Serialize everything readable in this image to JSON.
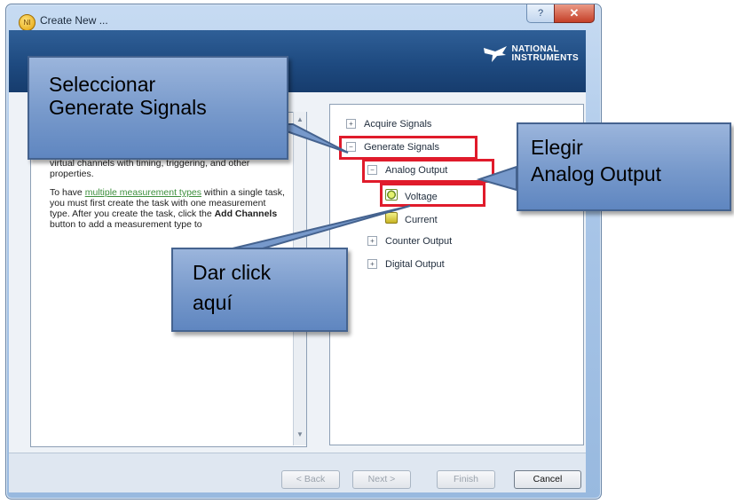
{
  "window": {
    "title": "Create New ...",
    "help_button": "?",
    "close_button": "✕"
  },
  "banner": {
    "logo_line1": "NATIONAL",
    "logo_line2": "INSTRUMENTS"
  },
  "help_panel": {
    "para1_fragment": "virtual channels with timing, triggering, and other properties.",
    "para2_pre": "To have ",
    "para2_link": "multiple measurement types",
    "para2_mid": " within a single task, you must first create the task with one measurement type. After you create the task, click the ",
    "para2_bold": "Add Channels",
    "para2_post": " button to add a measurement type to"
  },
  "tree": {
    "acquire_signals": "Acquire Signals",
    "generate_signals": "Generate Signals",
    "analog_output": "Analog Output",
    "voltage": "Voltage",
    "current": "Current",
    "counter_output": "Counter Output",
    "digital_output": "Digital Output"
  },
  "buttons": {
    "back": "< Back",
    "next": "Next >",
    "finish": "Finish",
    "cancel": "Cancel"
  },
  "callouts": {
    "select_line1": "Seleccionar",
    "select_line2": "Generate Signals",
    "choose_line1": "Elegir",
    "choose_line2": "Analog Output",
    "click_line1": "Dar click",
    "click_line2": "aquí"
  },
  "colors": {
    "highlight_box": "#e01b2b",
    "callout_fill": "#7799cb",
    "banner": "#1e4a80"
  }
}
